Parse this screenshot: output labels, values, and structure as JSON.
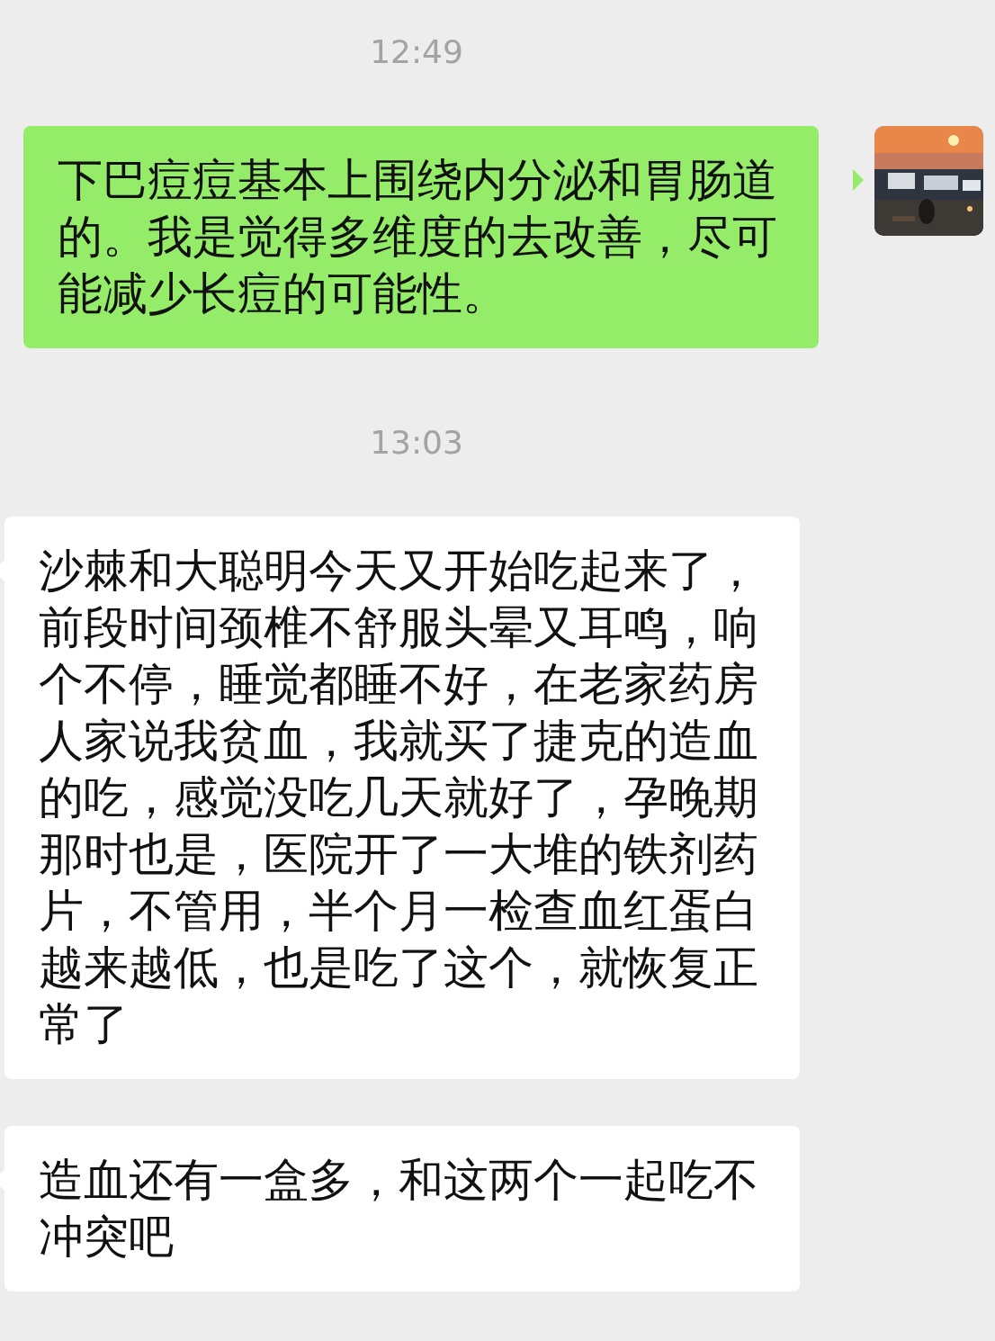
{
  "messages": [
    {
      "kind": "time",
      "text": "12:49"
    },
    {
      "kind": "outgoing",
      "text": "下巴痘痘基本上围绕内分泌和胃肠道的。我是觉得多维度的去改善，尽可能减少长痘的可能性。"
    },
    {
      "kind": "time",
      "text": "13:03"
    },
    {
      "kind": "incoming",
      "text": "沙棘和大聪明今天又开始吃起来了，前段时间颈椎不舒服头晕又耳鸣，响个不停，睡觉都睡不好，在老家药房人家说我贫血，我就买了捷克的造血的吃，感觉没吃几天就好了，孕晚期那时也是，医院开了一大堆的铁剂药片，不管用，半个月一检查血红蛋白越来越低，也是吃了这个，就恢复正常了"
    },
    {
      "kind": "incoming",
      "text": "造血还有一盒多，和这两个一起吃不冲突吧"
    }
  ]
}
